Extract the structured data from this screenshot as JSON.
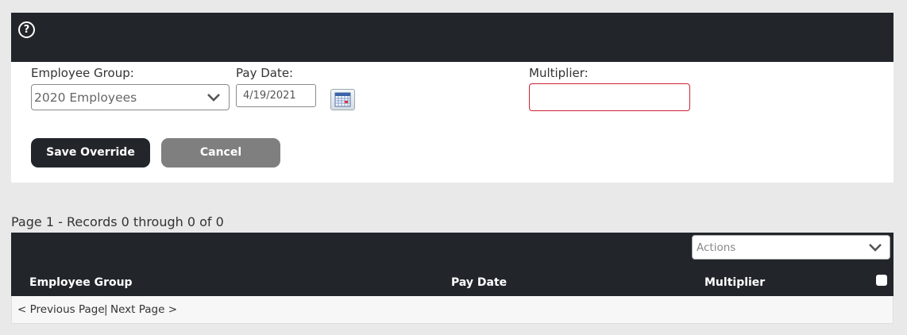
{
  "header": {
    "help_icon": "help-circle-icon"
  },
  "form": {
    "employee_group_label": "Employee Group:",
    "employee_group_value": "2020 Employees",
    "pay_date_label": "Pay Date:",
    "pay_date_value": "4/19/2021",
    "multiplier_label": "Multiplier:",
    "multiplier_value": "",
    "save_label": "Save Override",
    "cancel_label": "Cancel"
  },
  "grid": {
    "records_info": "Page 1 - Records 0 through 0 of 0",
    "actions_placeholder": "Actions",
    "columns": [
      "Employee Group",
      "Pay Date",
      "Multiplier"
    ],
    "pager": {
      "prev": "< Previous Page",
      "separator": "|",
      "next": "Next Page >"
    }
  },
  "colors": {
    "dark": "#22262b",
    "cancel": "#7f7f7f",
    "error_border": "#cc2233"
  }
}
